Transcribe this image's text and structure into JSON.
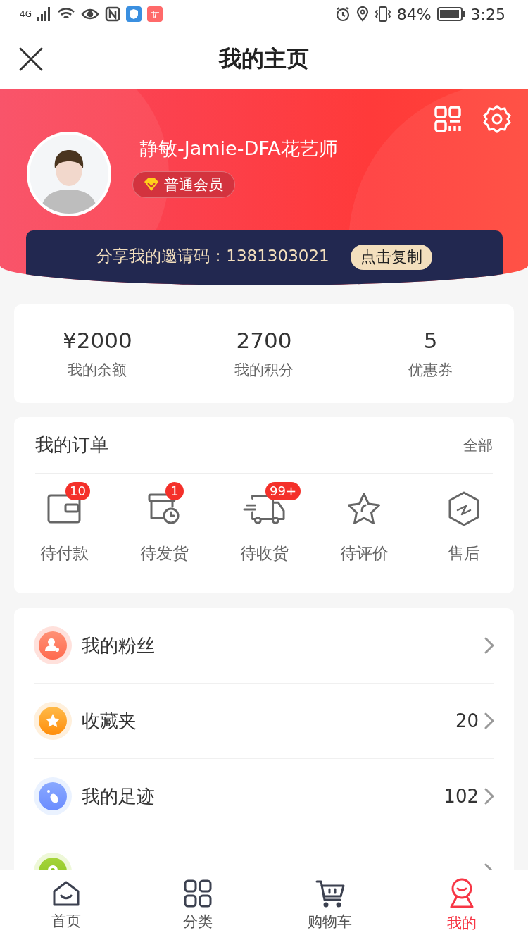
{
  "status_bar": {
    "network": "4G",
    "battery": "84%",
    "time": "3:25"
  },
  "header": {
    "title": "我的主页"
  },
  "profile": {
    "name": "静敏-Jamie-DFA花艺师",
    "member_level": "普通会员",
    "invite_text": "分享我的邀请码：1381303021",
    "copy_button": "点击复制"
  },
  "stats": [
    {
      "value": "¥2000",
      "label": "我的余额"
    },
    {
      "value": "2700",
      "label": "我的积分"
    },
    {
      "value": "5",
      "label": "优惠券"
    }
  ],
  "orders": {
    "title": "我的订单",
    "all_link": "全部",
    "items": [
      {
        "kind": "wallet",
        "label": "待付款",
        "badge": "10"
      },
      {
        "kind": "box",
        "label": "待发货",
        "badge": "1"
      },
      {
        "kind": "truck",
        "label": "待收货",
        "badge": "99+"
      },
      {
        "kind": "star",
        "label": "待评价"
      },
      {
        "kind": "hexagon",
        "label": "售后"
      }
    ]
  },
  "menu": [
    {
      "kind": "fans",
      "label": "我的粉丝"
    },
    {
      "kind": "favorites",
      "label": "收藏夹",
      "value": "20"
    },
    {
      "kind": "footprints",
      "label": "我的足迹",
      "value": "102"
    },
    {
      "kind": "address"
    }
  ],
  "tabs": [
    {
      "kind": "home",
      "label": "首页",
      "selected": false
    },
    {
      "kind": "grid",
      "label": "分类",
      "selected": false
    },
    {
      "kind": "cart",
      "label": "购物车",
      "selected": false
    },
    {
      "kind": "me",
      "label": "我的",
      "selected": true
    }
  ]
}
